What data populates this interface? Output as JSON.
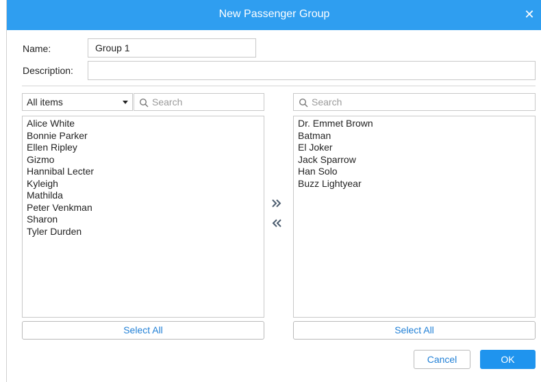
{
  "dialog": {
    "title": "New Passenger Group",
    "close_icon": "close-icon"
  },
  "form": {
    "name_label": "Name:",
    "name_value": "Group 1",
    "description_label": "Description:",
    "description_value": ""
  },
  "left_panel": {
    "filter_selected": "All items",
    "search_placeholder": "Search",
    "items": [
      "Alice White",
      "Bonnie Parker",
      "Ellen Ripley",
      "Gizmo",
      "Hannibal Lecter",
      "Kyleigh",
      "Mathilda",
      "Peter Venkman",
      "Sharon",
      "Tyler Durden"
    ],
    "select_all_label": "Select All"
  },
  "right_panel": {
    "search_placeholder": "Search",
    "items": [
      "Dr. Emmet Brown",
      "Batman",
      "El Joker",
      "Jack Sparrow",
      "Han Solo",
      "Buzz Lightyear"
    ],
    "select_all_label": "Select All"
  },
  "transfer": {
    "move_right_icon": "double-chevron-right-icon",
    "move_left_icon": "double-chevron-left-icon"
  },
  "footer": {
    "cancel_label": "Cancel",
    "ok_label": "OK"
  },
  "colors": {
    "title_bar": "#2f9ef0",
    "accent": "#1f7fd6",
    "ok_button": "#1f94ee"
  }
}
